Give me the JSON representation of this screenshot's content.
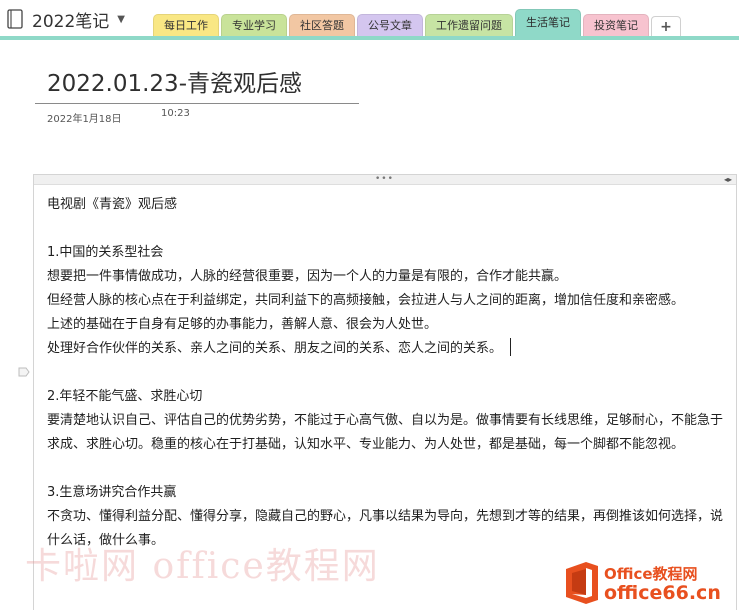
{
  "notebook": {
    "title": "2022笔记",
    "icon": "notebook-icon"
  },
  "tabs": [
    {
      "label": "每日工作",
      "color": "#f9e784"
    },
    {
      "label": "专业学习",
      "color": "#c9e39a"
    },
    {
      "label": "社区答题",
      "color": "#f2c7a3"
    },
    {
      "label": "公号文章",
      "color": "#d4c6ef"
    },
    {
      "label": "工作遗留问题",
      "color": "#c7e4a4"
    },
    {
      "label": "生活笔记",
      "color": "#8fd9c8",
      "active": true
    },
    {
      "label": "投资笔记",
      "color": "#f7c3cf"
    }
  ],
  "add_tab_label": "+",
  "accent_color": "#8fd9c8",
  "page": {
    "title": "2022.01.23-青瓷观后感",
    "date": "2022年1月18日",
    "time": "10:23"
  },
  "note": {
    "lines": [
      "电视剧《青瓷》观后感",
      "",
      "1.中国的关系型社会",
      "想要把一件事情做成功，人脉的经营很重要，因为一个人的力量是有限的，合作才能共赢。",
      "但经营人脉的核心点在于利益绑定，共同利益下的高频接触，会拉进人与人之间的距离，增加信任度和亲密感。",
      "上述的基础在于自身有足够的办事能力，善解人意、很会为人处世。",
      "处理好合作伙伴的关系、亲人之间的关系、朋友之间的关系、恋人之间的关系。",
      "",
      "2.年轻不能气盛、求胜心切",
      "要清楚地认识自己、评估自己的优势劣势，不能过于心高气傲、自以为是。做事情要有长线思维，足够耐心，不能急于求成、求胜心切。稳重的核心在于打基础，认知水平、专业能力、为人处世，都是基础，每一个脚都不能忽视。",
      "",
      "3.生意场讲究合作共赢",
      "不贪功、懂得利益分配、懂得分享，隐藏自己的野心，凡事以结果为导向，先想到才等的结果，再倒推该如何选择，说什么话，做什么事。"
    ]
  },
  "watermark": {
    "text": "卡啦网 office教程网",
    "logo_line1": "Office教程网",
    "logo_line2": "office66.cn"
  }
}
